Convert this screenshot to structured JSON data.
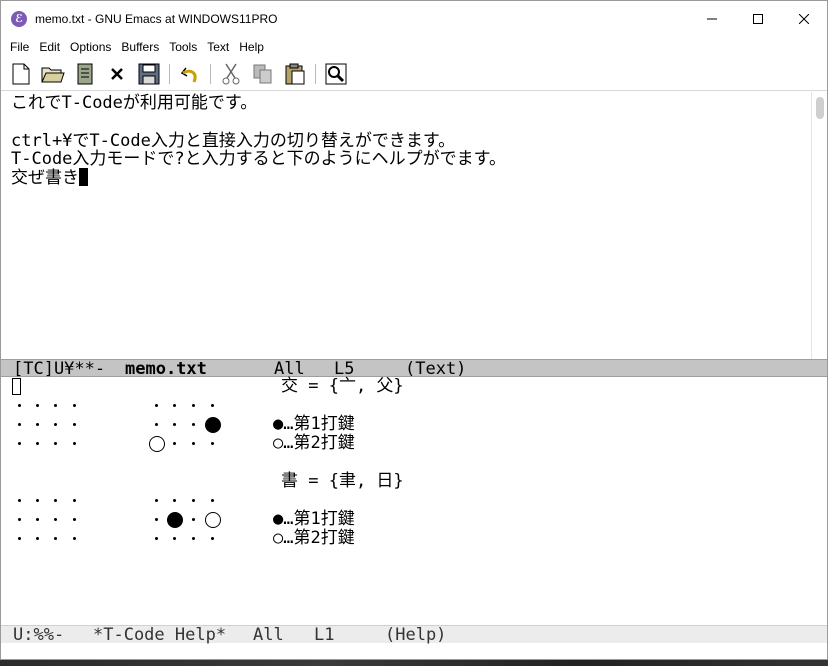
{
  "window": {
    "title": "memo.txt - GNU Emacs at WINDOWS11PRO",
    "app_icon": "emacs-icon"
  },
  "menu": [
    "File",
    "Edit",
    "Options",
    "Buffers",
    "Tools",
    "Text",
    "Help"
  ],
  "toolbar_icons": [
    "new-file-icon",
    "open-folder-icon",
    "dired-icon",
    "close-icon",
    "save-icon",
    "undo-icon",
    "cut-icon",
    "copy-icon",
    "paste-icon",
    "search-icon"
  ],
  "buffer": {
    "lines": [
      "これでT-Codeが利用可能です。",
      "",
      "ctrl+¥でT-Code入力と直接入力の切り替えができます。",
      "T-Code入力モードで?と入力すると下のようにヘルプがでます。",
      "交ぜ書き"
    ]
  },
  "modeline_top": {
    "status": "[TC]U¥**-",
    "buffer_name": "memo.txt",
    "position": "All",
    "line": "L5",
    "mode": "(Text)"
  },
  "help": {
    "entries": [
      {
        "formula": "交 = {亠, 父}",
        "first": [
          1,
          3
        ],
        "second": [
          2,
          0
        ]
      },
      {
        "formula": "書 = {聿, 日}",
        "first": [
          1,
          1
        ],
        "second": [
          1,
          3
        ]
      }
    ],
    "legend_first": "●…第1打鍵",
    "legend_second": "○…第2打鍵"
  },
  "modeline_bottom": {
    "status": "U:%%-",
    "buffer_name": "*T-Code Help*",
    "position": "All",
    "line": "L1",
    "mode": "(Help)"
  },
  "colors": {
    "modeline_active": "#c4c4c4",
    "modeline_inactive": "#ececec"
  }
}
